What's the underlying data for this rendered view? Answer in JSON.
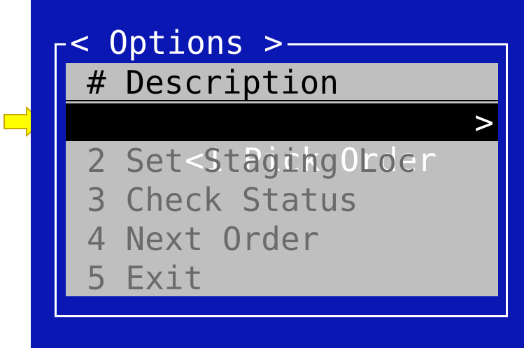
{
  "menu": {
    "title": "< Options >",
    "header": "# Description",
    "selected": {
      "prefix": "<1 Pick Order",
      "suffix": ">"
    },
    "items": [
      {
        "label": "2 Set Staging Loc"
      },
      {
        "label": "3 Check Status"
      },
      {
        "label": "4 Next Order"
      },
      {
        "label": "5 Exit"
      }
    ]
  },
  "colors": {
    "screen_background": "#0b17b3",
    "list_background": "#bfbfbf",
    "selection_background": "#000000",
    "arrow": "#ffff00"
  },
  "icons": {
    "pointer": "right-arrow-icon"
  }
}
